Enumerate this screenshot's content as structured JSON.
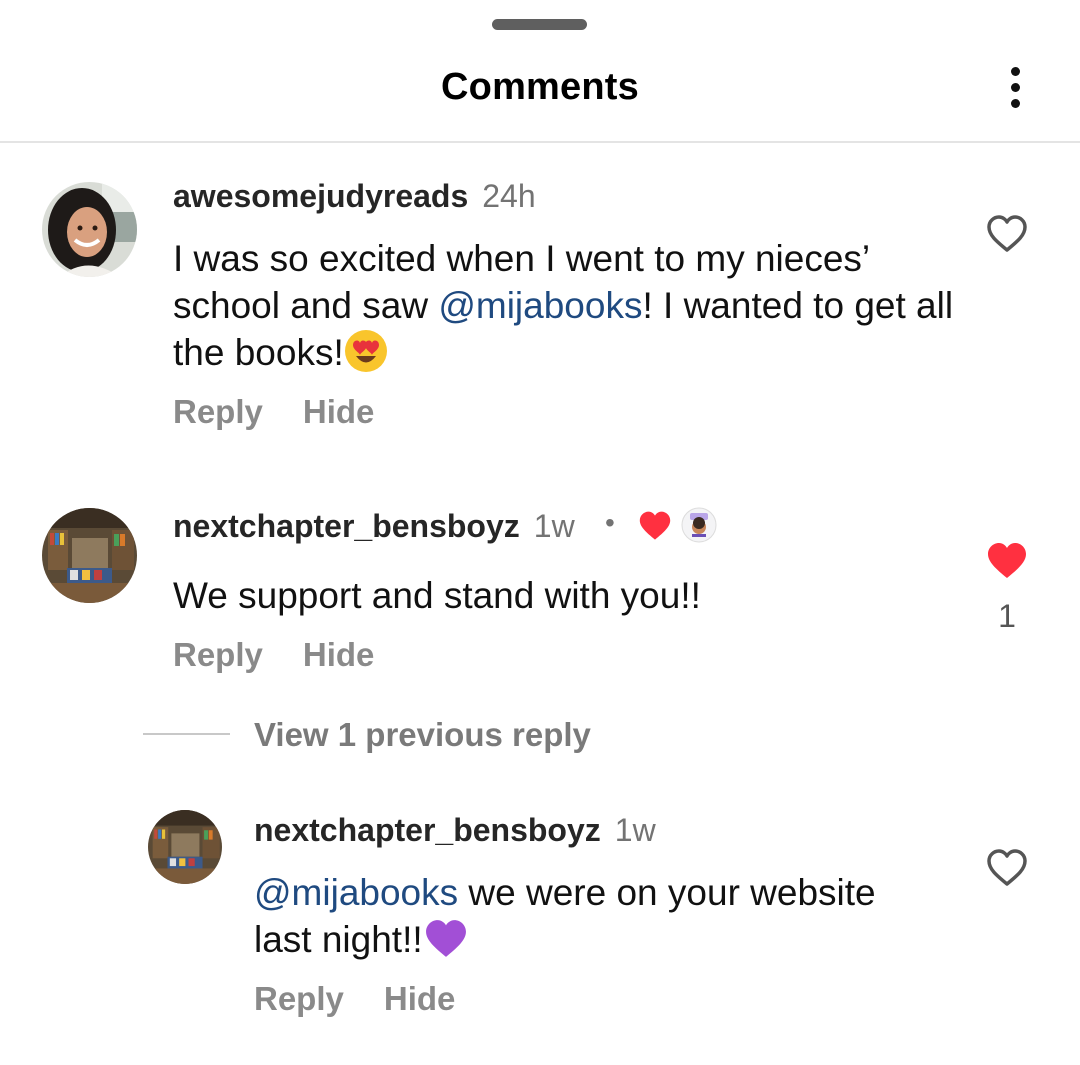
{
  "header": {
    "title": "Comments",
    "more_icon": "more-vertical-icon"
  },
  "comments": [
    {
      "username": "awesomejudyreads",
      "time": "24h",
      "text_before": "I was so excited when I went to my nieces’ school and saw ",
      "mention": "@mijabooks",
      "text_after": "! I wanted to get all the books!",
      "emoji": "heart-eyes-emoji",
      "reply_label": "Reply",
      "hide_label": "Hide",
      "liked": false
    },
    {
      "username": "nextchapter_bensboyz",
      "time": "1w",
      "separator": "•",
      "creator_liked": true,
      "text": "We support and stand with you!!",
      "reply_label": "Reply",
      "hide_label": "Hide",
      "liked": true,
      "like_count": "1"
    }
  ],
  "view_replies_label": "View 1 previous reply",
  "reply": {
    "username": "nextchapter_bensboyz",
    "time": "1w",
    "mention": "@mijabooks",
    "text_line1": " we were on your website",
    "text_line2": "last night!!",
    "emoji": "purple-heart-emoji",
    "reply_label": "Reply",
    "hide_label": "Hide",
    "liked": false
  },
  "colors": {
    "like_red": "#ff3040",
    "mention_blue": "#1f4a80",
    "secondary_gray": "#8a8a8a"
  }
}
